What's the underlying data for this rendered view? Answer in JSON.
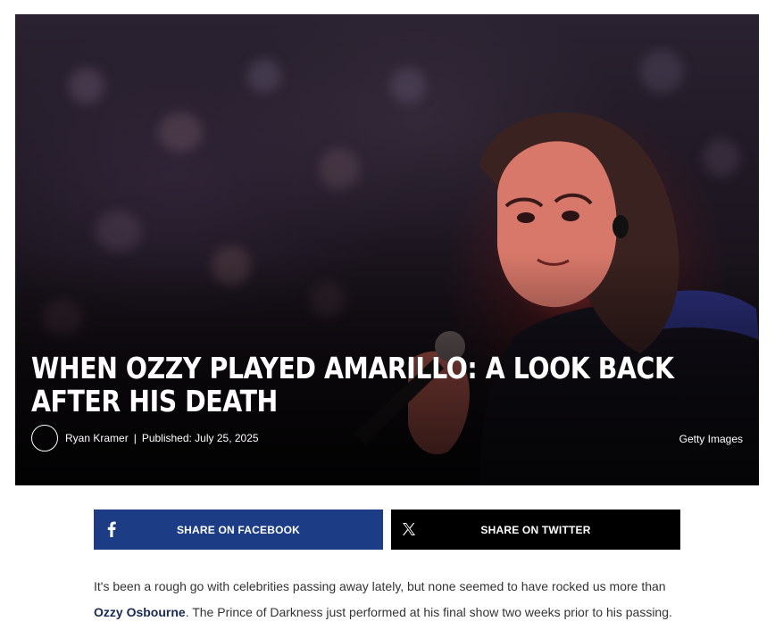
{
  "hero": {
    "title": "WHEN OZZY PLAYED AMARILLO: A LOOK BACK AFTER HIS DEATH",
    "author": "Ryan Kramer",
    "separator": "|",
    "published": "Published: July 25, 2025",
    "image_credit": "Getty Images"
  },
  "share": {
    "facebook_label": "SHARE ON FACEBOOK",
    "twitter_label": "SHARE ON TWITTER",
    "facebook_icon": "facebook-icon",
    "twitter_icon": "x-icon"
  },
  "article": {
    "intro_before": "It's been a rough go with celebrities passing away lately, but none seemed to have rocked us more than ",
    "intro_link": "Ozzy Osbourne",
    "intro_after": ". The Prince of Darkness just performed at his final show two weeks prior to his passing."
  },
  "colors": {
    "facebook": "#1c3d86",
    "twitter": "#000000",
    "link": "#1b2a52"
  }
}
